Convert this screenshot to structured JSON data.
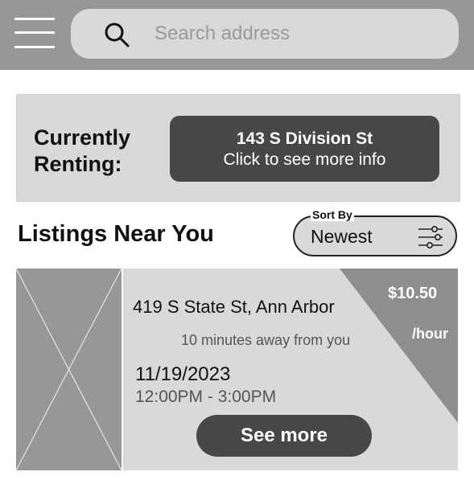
{
  "search": {
    "placeholder": "Search address"
  },
  "renting": {
    "label": "Currently Renting:",
    "address": "143 S Division St",
    "action_text": "Click to see more info"
  },
  "listings": {
    "title": "Listings Near You",
    "sort": {
      "caption": "Sort By",
      "value": "Newest"
    },
    "items": [
      {
        "address": "419 S State St, Ann Arbor",
        "distance": "10 minutes away from you",
        "date": "11/19/2023",
        "time": "12:00PM - 3:00PM",
        "price": "$10.50",
        "price_unit": "/hour",
        "button_label": "See more"
      }
    ]
  },
  "colors": {
    "topbar": "#979797",
    "panel": "#d9d9d9",
    "button_dark": "#474747",
    "price_wedge": "#8e8e8e"
  },
  "icons": {
    "menu": "hamburger-menu-icon",
    "search": "search-icon",
    "filter": "filter-sliders-icon",
    "image_placeholder": "image-placeholder-icon"
  }
}
